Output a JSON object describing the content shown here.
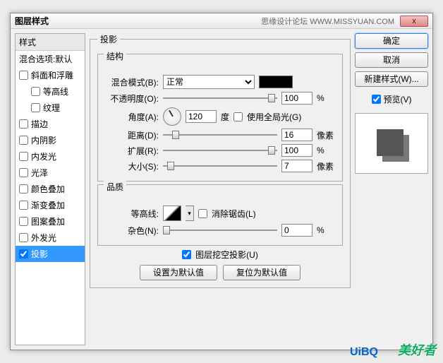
{
  "window": {
    "title": "图层样式",
    "subtitle": "思缘设计论坛  WWW.MISSYUAN.COM",
    "close": "x"
  },
  "sidebar": {
    "header": "样式",
    "blend": "混合选项:默认",
    "items": [
      {
        "label": "斜面和浮雕"
      },
      {
        "label": "等高线",
        "indent": true
      },
      {
        "label": "纹理",
        "indent": true
      },
      {
        "label": "描边"
      },
      {
        "label": "内阴影"
      },
      {
        "label": "内发光"
      },
      {
        "label": "光泽"
      },
      {
        "label": "颜色叠加"
      },
      {
        "label": "渐变叠加"
      },
      {
        "label": "图案叠加"
      },
      {
        "label": "外发光"
      },
      {
        "label": "投影",
        "selected": true,
        "checked": true
      }
    ]
  },
  "panel": {
    "title": "投影",
    "struct": {
      "legend": "结构",
      "blendmode_lbl": "混合模式(B):",
      "blendmode_val": "正常",
      "opacity_lbl": "不透明度(O):",
      "opacity_val": "100",
      "opacity_unit": "%",
      "angle_lbl": "角度(A):",
      "angle_val": "120",
      "angle_unit": "度",
      "global_lbl": "使用全局光(G)",
      "distance_lbl": "距离(D):",
      "distance_val": "16",
      "distance_unit": "像素",
      "spread_lbl": "扩展(R):",
      "spread_val": "100",
      "spread_unit": "%",
      "size_lbl": "大小(S):",
      "size_val": "7",
      "size_unit": "像素"
    },
    "quality": {
      "legend": "品质",
      "contour_lbl": "等高线:",
      "antialias_lbl": "消除锯齿(L)",
      "noise_lbl": "杂色(N):",
      "noise_val": "0",
      "noise_unit": "%"
    },
    "knockout_lbl": "图层挖空投影(U)",
    "defaults_btn": "设置为默认值",
    "reset_btn": "复位为默认值"
  },
  "right": {
    "ok": "确定",
    "cancel": "取消",
    "newstyle": "新建样式(W)...",
    "preview_lbl": "预览(V)"
  },
  "wm1": "UiBQ",
  "wm2": "美好者"
}
